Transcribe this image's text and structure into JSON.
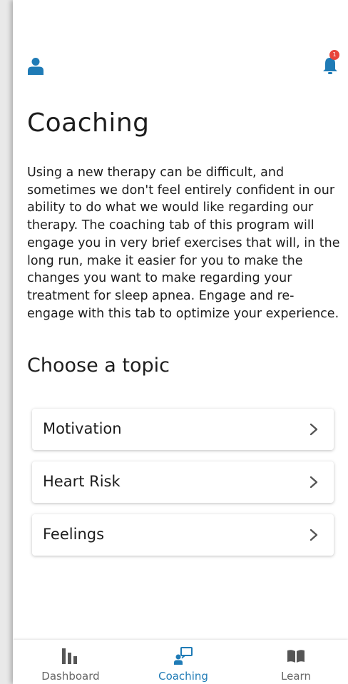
{
  "colors": {
    "accent": "#1f7bb6",
    "badge": "#e8453c",
    "text": "#1d1d1d",
    "muted": "#666666",
    "inactive_icon": "#555555"
  },
  "header": {
    "profile_icon": "person-icon",
    "notifications_icon": "bell-icon",
    "notification_count": "1"
  },
  "page": {
    "title": "Coaching",
    "intro": "Using a new therapy can be difficult, and sometimes we don't feel entirely confident in our ability to do what we would like regarding our therapy. The coaching tab of this program will engage you in very brief exercises that will, in the long run, make it easier for you to make the changes you want to make regarding your treatment for sleep apnea. Engage and re-engage with this tab to optimize your experience.",
    "section_title": "Choose a topic"
  },
  "topics": [
    {
      "label": "Motivation"
    },
    {
      "label": "Heart Risk"
    },
    {
      "label": "Feelings"
    }
  ],
  "tabs": [
    {
      "label": "Dashboard",
      "icon": "bar-chart-icon",
      "active": false
    },
    {
      "label": "Coaching",
      "icon": "coaching-icon",
      "active": true
    },
    {
      "label": "Learn",
      "icon": "book-icon",
      "active": false
    }
  ]
}
